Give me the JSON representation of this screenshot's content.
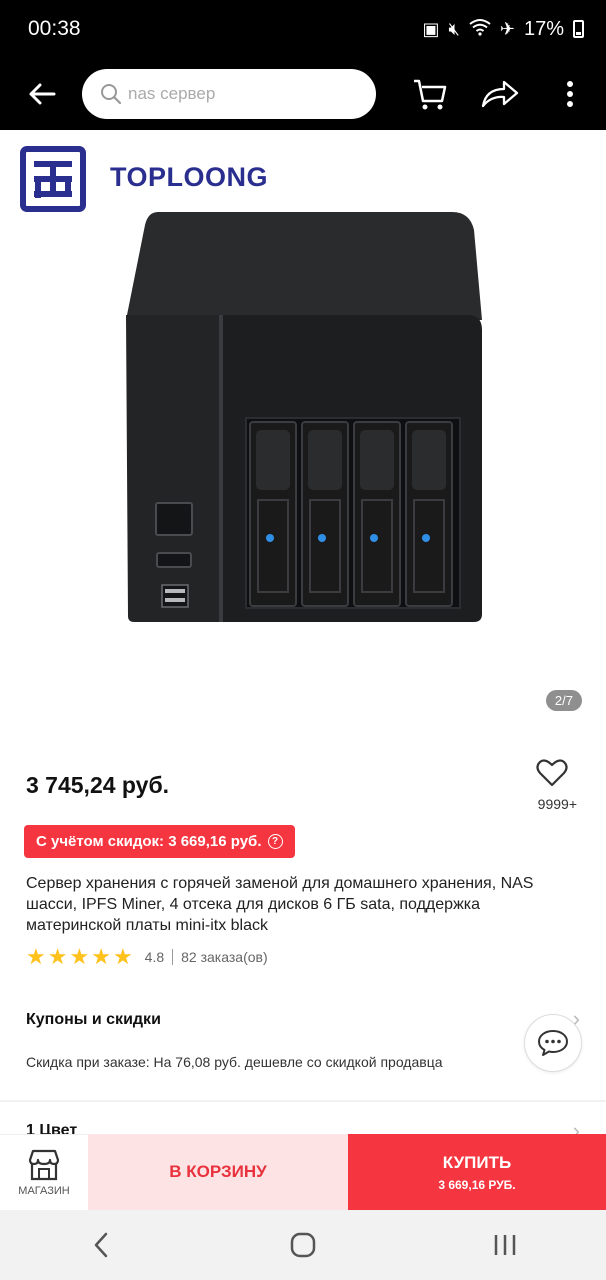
{
  "status_bar": {
    "time": "00:38",
    "battery": "17%"
  },
  "search": {
    "placeholder": "nas сервер"
  },
  "brand": {
    "name": "TOPLOONG"
  },
  "gallery": {
    "counter": "2/7"
  },
  "product": {
    "price": "3 745,24 руб.",
    "favorites_count": "9999+",
    "discount_badge": "С учётом скидок: 3 669,16 руб.",
    "title": "Сервер хранения с горячей заменой для домашнего хранения, NAS шасси, IPFS Miner, 4 отсека для дисков 6 ГБ sata, поддержка материнской платы mini-itx black",
    "rating": "4.8",
    "stars": 5,
    "orders": "82 заказа(ов)"
  },
  "coupons": {
    "title": "Купоны и скидки",
    "text": "Скидка при заказе: На 76,08 руб. дешевле со скидкой продавца"
  },
  "options": {
    "color_row": "1 Цвет"
  },
  "actions": {
    "shop_label": "МАГАЗИН",
    "cart_label": "В КОРЗИНУ",
    "buy_label": "КУПИТЬ",
    "buy_price": "3 669,16 РУБ."
  },
  "colors": {
    "accent": "#f5353f",
    "cart_bg": "#fde3e4",
    "star": "#ffc21d",
    "brand": "#2a2f8f"
  }
}
